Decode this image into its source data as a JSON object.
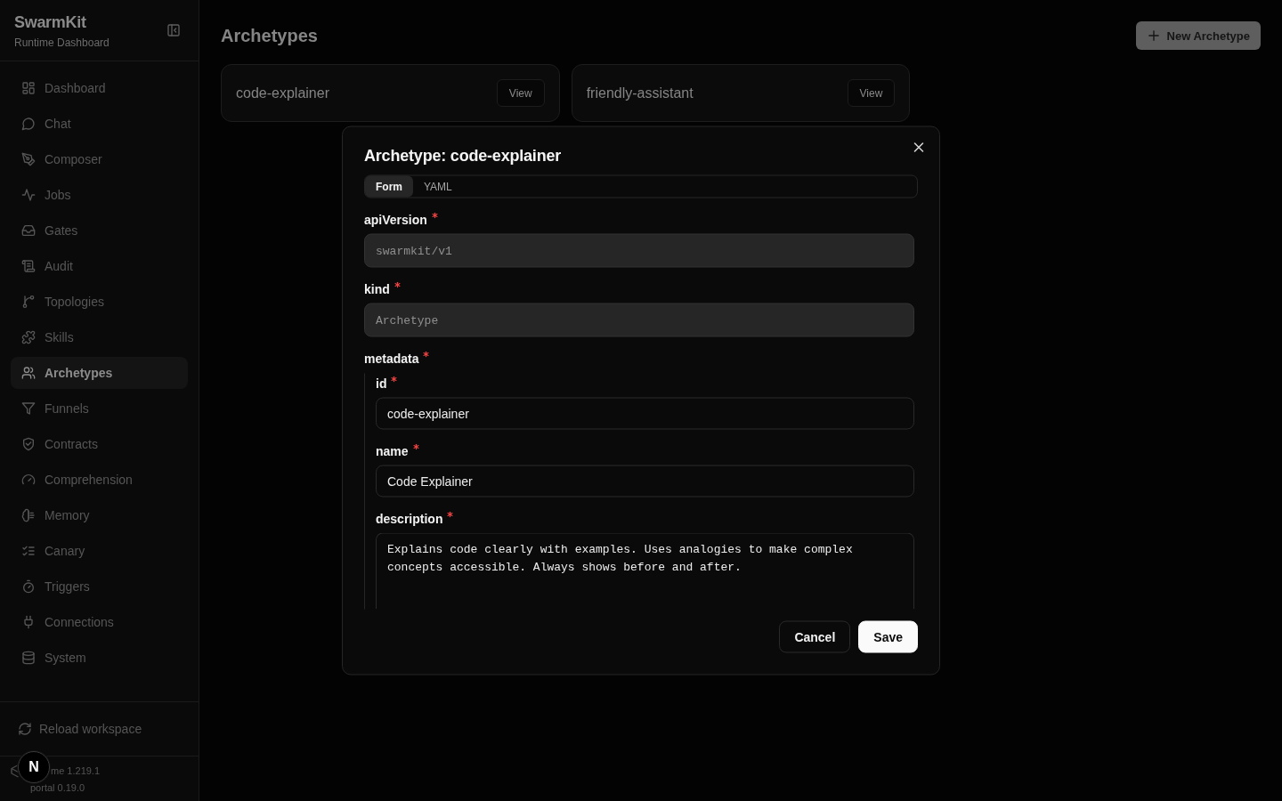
{
  "sidebar": {
    "title": "SwarmKit",
    "subtitle": "Runtime Dashboard",
    "nav": [
      {
        "label": "Dashboard",
        "selected": false
      },
      {
        "label": "Chat",
        "selected": false
      },
      {
        "label": "Composer",
        "selected": false
      },
      {
        "label": "Jobs",
        "selected": false
      },
      {
        "label": "Gates",
        "selected": false
      },
      {
        "label": "Audit",
        "selected": false
      },
      {
        "label": "Topologies",
        "selected": false
      },
      {
        "label": "Skills",
        "selected": false
      },
      {
        "label": "Archetypes",
        "selected": true
      },
      {
        "label": "Funnels",
        "selected": false
      },
      {
        "label": "Contracts",
        "selected": false
      },
      {
        "label": "Comprehension",
        "selected": false
      },
      {
        "label": "Memory",
        "selected": false
      },
      {
        "label": "Canary",
        "selected": false
      },
      {
        "label": "Triggers",
        "selected": false
      },
      {
        "label": "Connections",
        "selected": false
      },
      {
        "label": "System",
        "selected": false
      }
    ],
    "reload_button": "Reload workspace",
    "versions": [
      "me 1.219.1",
      "portal 0.19.0"
    ]
  },
  "page": {
    "title": "Archetypes",
    "new_button": "New Archetype",
    "cards": [
      {
        "name": "code-explainer",
        "action": "View"
      },
      {
        "name": "friendly-assistant",
        "action": "View"
      }
    ]
  },
  "modal": {
    "title": "Archetype: code-explainer",
    "tabs": [
      {
        "label": "Form",
        "selected": true
      },
      {
        "label": "YAML",
        "selected": false
      }
    ],
    "fields": [
      {
        "label": "apiVersion",
        "required": true,
        "kind": "readonly",
        "value": "swarmkit/v1"
      },
      {
        "label": "kind",
        "required": true,
        "kind": "readonly",
        "value": "Archetype"
      },
      {
        "label": "metadata",
        "required": true,
        "kind": "group",
        "children": [
          {
            "label": "id",
            "required": true,
            "kind": "text",
            "value": "code-explainer"
          },
          {
            "label": "name",
            "required": true,
            "kind": "text",
            "value": "Code Explainer"
          },
          {
            "label": "description",
            "required": true,
            "kind": "textarea",
            "value": "Explains code clearly with examples. Uses analogies to make complex concepts accessible. Always shows before and after."
          }
        ]
      }
    ],
    "buttons": [
      {
        "label": "Cancel",
        "kind": "secondary"
      },
      {
        "label": "Save",
        "kind": "primary"
      }
    ]
  },
  "dev_badge": {
    "label": "N"
  }
}
